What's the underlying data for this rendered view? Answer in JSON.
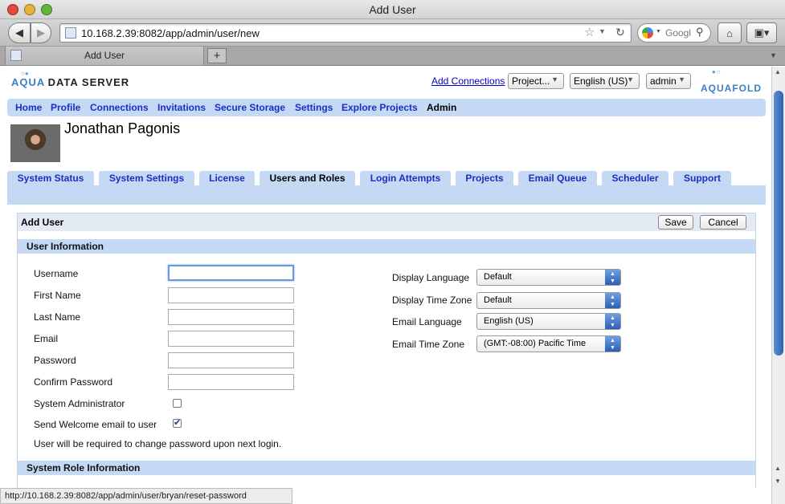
{
  "window": {
    "title": "Add User"
  },
  "browser": {
    "url": "10.168.2.39:8082/app/admin/user/new",
    "search_placeholder": "Googl",
    "tab_label": "Add User",
    "new_tab": "+",
    "status_url": "http://10.168.2.39:8082/app/admin/user/bryan/reset-password"
  },
  "header": {
    "logo_word1": "AQUA",
    "logo_word2": "DATA SERVER",
    "logo_right": "AQUAFOLD",
    "add_connections": "Add Connections",
    "project_select": "Project...",
    "language_select": "English (US)",
    "user_select": "admin"
  },
  "mainnav": {
    "items": [
      "Home",
      "Profile",
      "Connections",
      "Invitations",
      "Secure Storage",
      "Settings",
      "Explore Projects",
      "Admin"
    ],
    "current": "Admin"
  },
  "user": {
    "name": "Jonathan Pagonis"
  },
  "subtabs": {
    "items": [
      "System Status",
      "System Settings",
      "License",
      "Users and Roles",
      "Login Attempts",
      "Projects",
      "Email Queue",
      "Scheduler",
      "Support"
    ],
    "current": "Users and Roles"
  },
  "form": {
    "title": "Add User",
    "save": "Save",
    "cancel": "Cancel",
    "section_user_info": "User Information",
    "section_role_info": "System Role Information",
    "fields": {
      "username": {
        "label": "Username",
        "value": ""
      },
      "first_name": {
        "label": "First Name",
        "value": ""
      },
      "last_name": {
        "label": "Last Name",
        "value": ""
      },
      "email": {
        "label": "Email",
        "value": ""
      },
      "password": {
        "label": "Password",
        "value": ""
      },
      "confirm_password": {
        "label": "Confirm Password",
        "value": ""
      }
    },
    "sys_admin": {
      "label": "System Administrator",
      "checked": false
    },
    "send_welcome": {
      "label": "Send Welcome email to user",
      "checked": true
    },
    "note": "User will be required to change password upon next login.",
    "display_language": {
      "label": "Display Language",
      "value": "Default"
    },
    "display_time_zone": {
      "label": "Display Time Zone",
      "value": "Default"
    },
    "email_language": {
      "label": "Email Language",
      "value": "English (US)"
    },
    "email_time_zone": {
      "label": "Email Time Zone",
      "value": "(GMT:-08:00) Pacific Time"
    }
  }
}
